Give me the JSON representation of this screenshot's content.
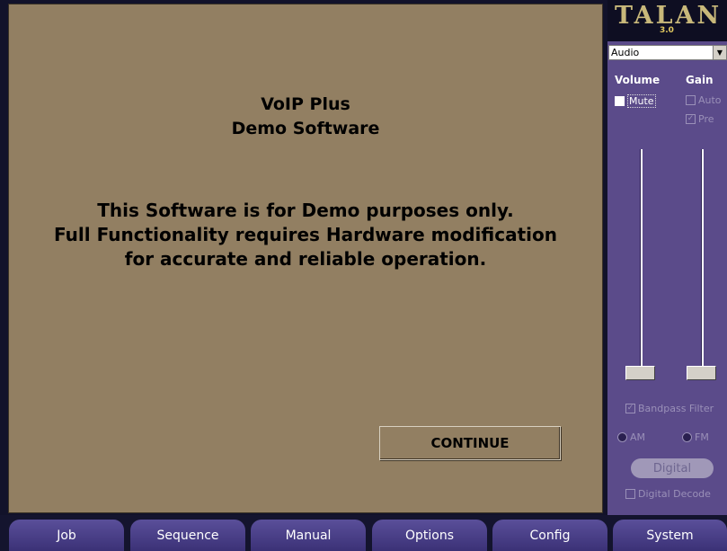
{
  "main": {
    "title_line1": "VoIP Plus",
    "title_line2": "Demo Software",
    "message_line1": "This Software is for Demo purposes only.",
    "message_line2": "Full Functionality requires Hardware modification",
    "message_line3": "for accurate and reliable operation.",
    "continue_label": "CONTINUE"
  },
  "side": {
    "logo": "TALAN",
    "version": "3.0",
    "source_select": "Audio",
    "volume_label": "Volume",
    "gain_label": "Gain",
    "mute_label": "Mute",
    "auto_label": "Auto",
    "pre_label": "Pre",
    "pre_check": "✓",
    "bandpass_label": "Bandpass Filter",
    "bandpass_check": "✓",
    "am_label": "AM",
    "fm_label": "FM",
    "digital_label": "Digital",
    "digital_decode_label": "Digital Decode"
  },
  "nav": {
    "job": "Job",
    "sequence": "Sequence",
    "manual": "Manual",
    "options": "Options",
    "config": "Config",
    "system": "System"
  }
}
